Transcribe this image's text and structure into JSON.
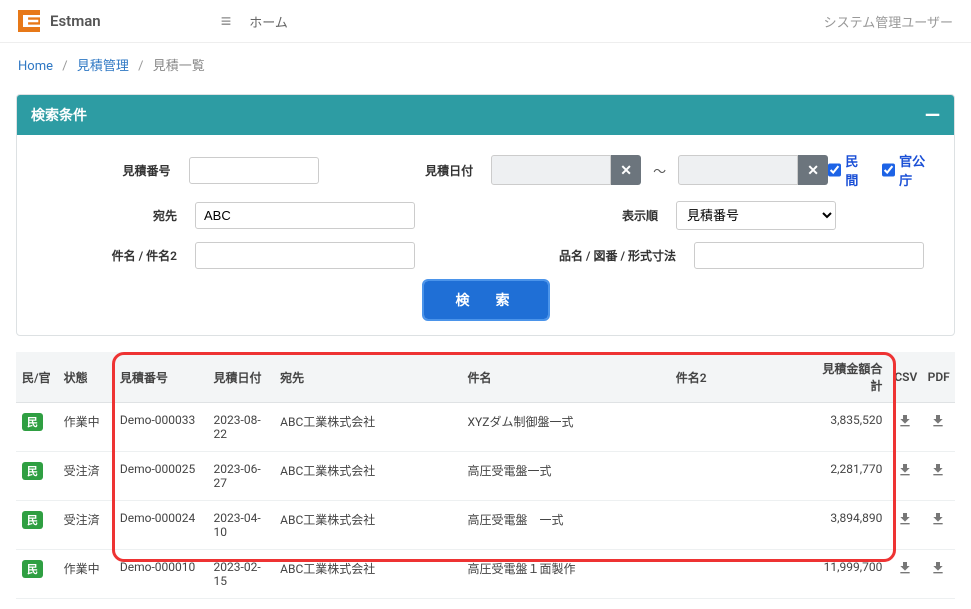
{
  "header": {
    "brand": "Estman",
    "nav_home": "ホーム",
    "user": "システム管理ユーザー"
  },
  "breadcrumb": {
    "home": "Home",
    "mgmt": "見積管理",
    "current": "見積一覧"
  },
  "search": {
    "panel_title": "検索条件",
    "labels": {
      "number": "見積番号",
      "date": "見積日付",
      "dest": "宛先",
      "sort": "表示順",
      "kname": "件名 / 件名2",
      "pname": "品名 / 図番 / 形式寸法"
    },
    "values": {
      "number": "",
      "date_from": "",
      "date_to": "",
      "dest": "ABC",
      "sort": "見積番号",
      "kname": "",
      "pname": ""
    },
    "checkboxes": {
      "minkan_label": "民間",
      "kankocho_label": "官公庁"
    },
    "button": "検　索"
  },
  "table": {
    "headers": {
      "mk": "民/官",
      "status": "状態",
      "number": "見積番号",
      "date": "見積日付",
      "dest": "宛先",
      "kname": "件名",
      "kname2": "件名2",
      "amount": "見積金額合計",
      "csv": "CSV",
      "pdf": "PDF"
    },
    "rows": [
      {
        "mk": "民",
        "status": "作業中",
        "number": "Demo-000033",
        "date": "2023-08-22",
        "dest": "ABC工業株式会社",
        "kname": "XYZダム制御盤一式",
        "kname2": "",
        "amount": "3,835,520"
      },
      {
        "mk": "民",
        "status": "受注済",
        "number": "Demo-000025",
        "date": "2023-06-27",
        "dest": "ABC工業株式会社",
        "kname": "高圧受電盤一式",
        "kname2": "",
        "amount": "2,281,770"
      },
      {
        "mk": "民",
        "status": "受注済",
        "number": "Demo-000024",
        "date": "2023-04-10",
        "dest": "ABC工業株式会社",
        "kname": "高圧受電盤　一式",
        "kname2": "",
        "amount": "3,894,890"
      },
      {
        "mk": "民",
        "status": "作業中",
        "number": "Demo-000010",
        "date": "2023-02-15",
        "dest": "ABC工業株式会社",
        "kname": "高圧受電盤１面製作",
        "kname2": "",
        "amount": "11,999,700"
      }
    ]
  }
}
